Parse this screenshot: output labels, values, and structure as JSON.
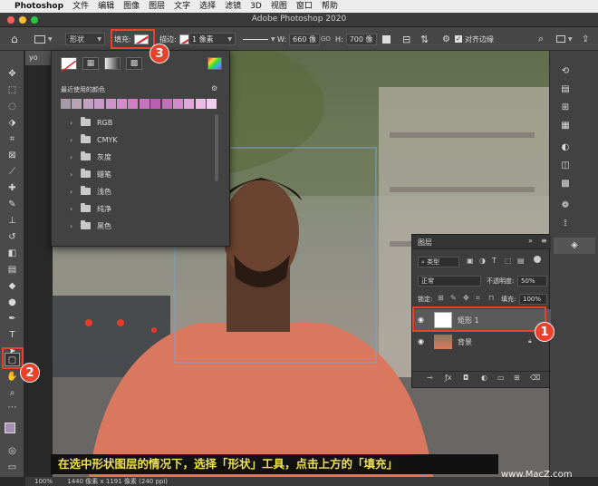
{
  "menubar": {
    "app": "Photoshop",
    "items": [
      "文件",
      "编辑",
      "图像",
      "图层",
      "文字",
      "选择",
      "滤镜",
      "3D",
      "视图",
      "窗口",
      "帮助"
    ]
  },
  "window": {
    "title": "Adobe Photoshop 2020"
  },
  "options": {
    "mode": "形状",
    "fill_label": "填充:",
    "stroke_label": "描边:",
    "stroke_width": "1 像素",
    "w_label": "W:",
    "w_value": "660 像",
    "link_label": "GO",
    "h_label": "H:",
    "h_value": "700 像",
    "align_edges": "对齐边缘"
  },
  "document": {
    "tab": "yo"
  },
  "fill_popup": {
    "recent_label": "最近使用的颜色",
    "swatches": [
      "#a69aa6",
      "#b6a3b3",
      "#c1a1bf",
      "#c99ac6",
      "#ce93c9",
      "#d58ccf",
      "#cf7fc6",
      "#c477bd",
      "#b960b2",
      "#c070b8",
      "#d18dcb",
      "#e0a7da",
      "#eabde6",
      "#f2cdef"
    ],
    "folders": [
      "RGB",
      "CMYK",
      "灰度",
      "蜡笔",
      "浅色",
      "纯净",
      "黑色"
    ]
  },
  "layers_panel": {
    "title": "图层",
    "filter_label": "类型",
    "blend_mode": "正常",
    "opacity_label": "不透明度:",
    "opacity_value": "50%",
    "lock_label": "锁定:",
    "fill_label": "填充:",
    "fill_value": "100%",
    "layers": [
      {
        "name": "矩形 1",
        "selected": true
      },
      {
        "name": "背景",
        "selected": false
      }
    ]
  },
  "status": {
    "zoom": "100%",
    "info": "1440 像素 x 1191 像素 (240 ppi)"
  },
  "annotations": {
    "badge1": "1",
    "badge2": "2",
    "badge3": "3",
    "caption": "在选中形状图层的情况下，选择「形状」工具，点击上方的「填充」",
    "watermark": "www.MacZ.com"
  },
  "colors": {
    "annotation_red": "#e8412c",
    "caption_text": "#f0e050",
    "panel_bg": "#424242"
  }
}
